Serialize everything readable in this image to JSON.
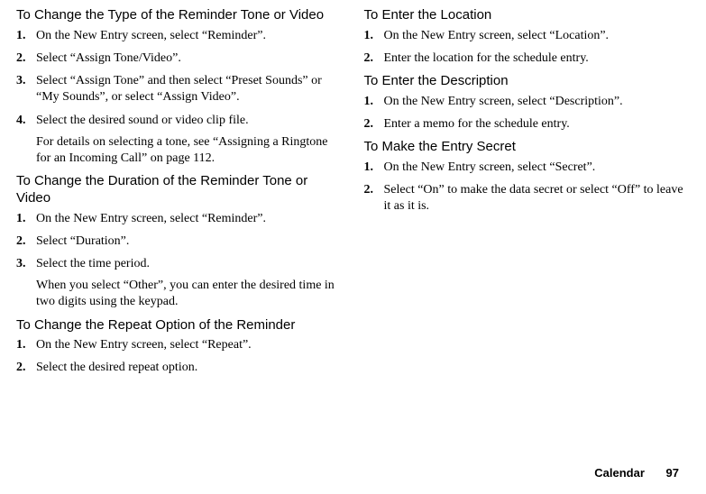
{
  "left": {
    "sections": [
      {
        "heading": "To Change the Type of the Reminder Tone or Video",
        "items": [
          {
            "text": "On the New Entry screen, select “Reminder”."
          },
          {
            "text": "Select “Assign Tone/Video”."
          },
          {
            "text": "Select “Assign Tone” and then select “Preset Sounds” or “My Sounds”, or select “Assign Video”."
          },
          {
            "text": "Select the desired sound or video clip file.",
            "note": "For details on selecting a tone, see “Assigning a Ringtone for an Incoming Call” on page 112."
          }
        ]
      },
      {
        "heading": "To Change the Duration of the Reminder Tone or Video",
        "items": [
          {
            "text": "On the New Entry screen, select “Reminder”."
          },
          {
            "text": "Select “Duration”."
          },
          {
            "text": "Select the time period.",
            "note": "When you select “Other”, you can enter the desired time in two digits using the keypad."
          }
        ]
      },
      {
        "heading": "To Change the Repeat Option of the Reminder",
        "items": [
          {
            "text": "On the New Entry screen, select “Repeat”."
          },
          {
            "text": "Select the desired repeat option."
          }
        ]
      }
    ]
  },
  "right": {
    "sections": [
      {
        "heading": "To Enter the Location",
        "items": [
          {
            "text": "On the New Entry screen, select “Location”."
          },
          {
            "text": "Enter the location for the schedule entry."
          }
        ]
      },
      {
        "heading": "To Enter the Description",
        "items": [
          {
            "text": "On the New Entry screen, select “Description”."
          },
          {
            "text": "Enter a memo for the schedule entry."
          }
        ]
      },
      {
        "heading": "To Make the Entry Secret",
        "items": [
          {
            "text": "On the New Entry screen, select “Secret”."
          },
          {
            "text": "Select “On” to make the data secret or select “Off” to leave it as it is."
          }
        ]
      }
    ]
  },
  "footer": {
    "label": "Calendar",
    "page": "97"
  }
}
